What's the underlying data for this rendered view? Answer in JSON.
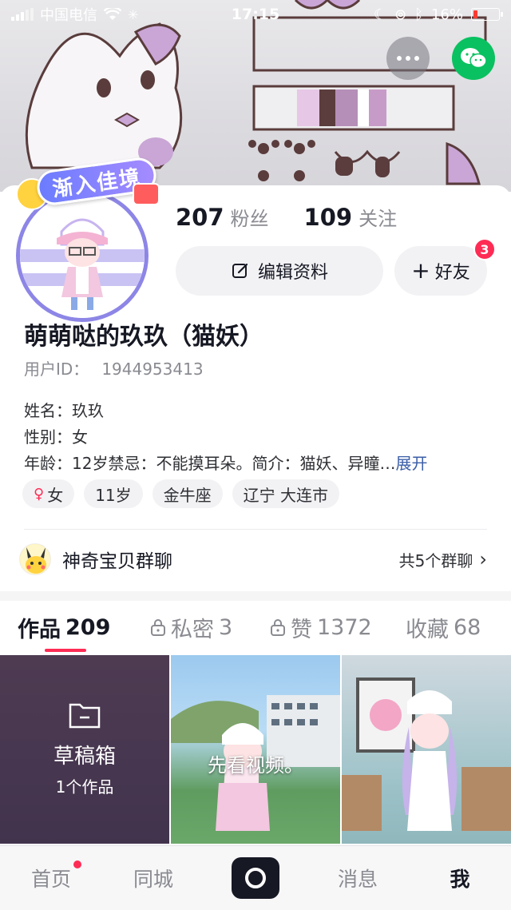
{
  "status_bar": {
    "carrier": "中国电信",
    "time": "17:15",
    "battery": "16%",
    "battery_level": 0.16
  },
  "profile": {
    "avatar_frame_label": "渐入佳境",
    "fans_count": "207",
    "fans_label": "粉丝",
    "following_count": "109",
    "following_label": "关注",
    "edit_label": "编辑资料",
    "add_friend_label": "好友",
    "friend_badge": "3",
    "nickname": "萌萌哒的玖玖（猫妖）",
    "user_id_label": "用户ID：",
    "user_id": "1944953413",
    "bio_lines": [
      "姓名：玖玖",
      "性别：女",
      "年龄：12岁禁忌：不能摸耳朵。简介：猫妖、异瞳…"
    ],
    "expand_label": "展开",
    "tags": [
      "女",
      "11岁",
      "金牛座",
      "辽宁 大连市"
    ]
  },
  "group": {
    "name": "神奇宝贝群聊",
    "count_label": "共5个群聊"
  },
  "tabs": [
    {
      "label": "作品",
      "count": "209",
      "locked": false
    },
    {
      "label": "私密",
      "count": "3",
      "locked": true
    },
    {
      "label": "赞",
      "count": "1372",
      "locked": true
    },
    {
      "label": "收藏",
      "count": "68",
      "locked": false
    }
  ],
  "grid": {
    "draft_title": "草稿箱",
    "draft_sub": "1个作品",
    "video_caption": "先看视频。"
  },
  "bottom_nav": [
    "首页",
    "同城",
    "消息",
    "我"
  ],
  "colors": {
    "accent": "#fe2c55",
    "wechat": "#09c160",
    "avatar_ring": "#8d86e6"
  }
}
